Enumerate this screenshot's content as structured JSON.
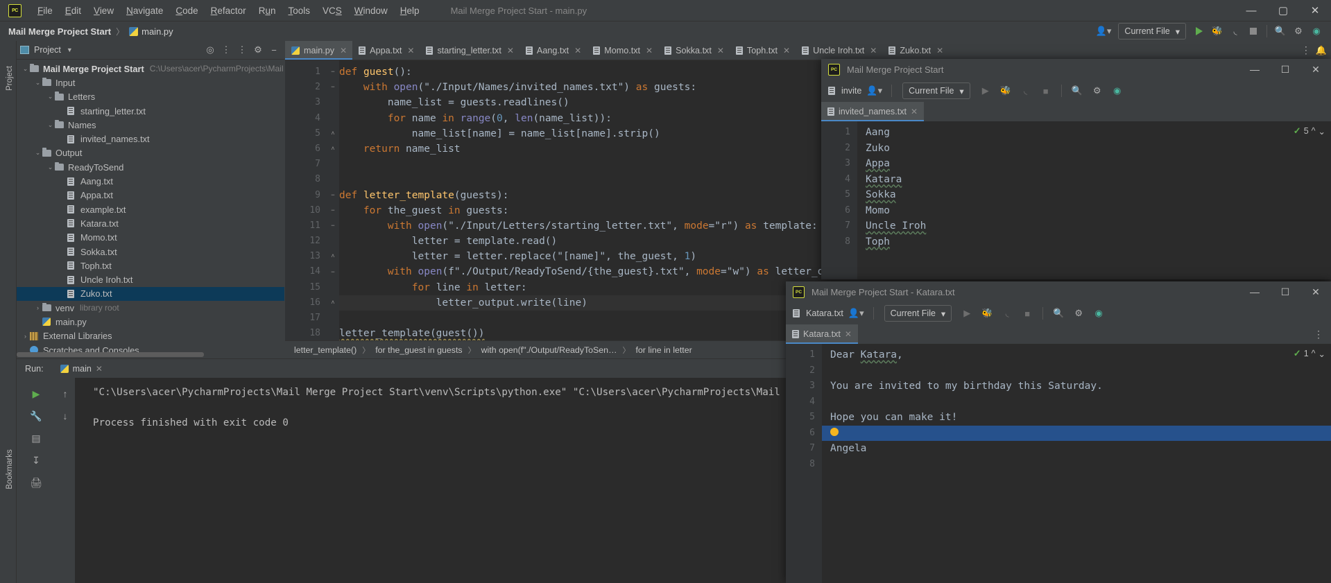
{
  "window": {
    "title": "Mail Merge Project Start - main.py",
    "app_icon": "PC",
    "minimize": "—",
    "maximize": "▢",
    "close": "✕"
  },
  "menu": [
    {
      "label": "File"
    },
    {
      "label": "Edit"
    },
    {
      "label": "View"
    },
    {
      "label": "Navigate"
    },
    {
      "label": "Code"
    },
    {
      "label": "Refactor"
    },
    {
      "label": "Run"
    },
    {
      "label": "Tools"
    },
    {
      "label": "VCS"
    },
    {
      "label": "Window"
    },
    {
      "label": "Help"
    }
  ],
  "navbar": {
    "project": "Mail Merge Project Start",
    "separator": "〉",
    "file": "main.py",
    "run_config": "Current File",
    "icons": [
      "user-dropdown-icon",
      "run-icon",
      "debug-icon",
      "coverage-icon",
      "stop-icon",
      "search-icon",
      "settings-icon",
      "ide-assistant-icon"
    ]
  },
  "left_strip": {
    "project_label": "Project",
    "bookmarks_label": "Bookmarks"
  },
  "project_panel": {
    "title": "Project",
    "actions": [
      "locate-icon",
      "expand-all-icon",
      "collapse-all-icon",
      "settings-icon",
      "hide-icon"
    ],
    "tree": [
      {
        "label": "Mail Merge Project Start",
        "path": "C:\\Users\\acer\\PycharmProjects\\Mail M",
        "depth": 0,
        "type": "folder",
        "arrow": "⌄",
        "bold": true
      },
      {
        "label": "Input",
        "depth": 1,
        "type": "folder",
        "arrow": "⌄"
      },
      {
        "label": "Letters",
        "depth": 2,
        "type": "folder",
        "arrow": "⌄"
      },
      {
        "label": "starting_letter.txt",
        "depth": 3,
        "type": "txt"
      },
      {
        "label": "Names",
        "depth": 2,
        "type": "folder",
        "arrow": "⌄"
      },
      {
        "label": "invited_names.txt",
        "depth": 3,
        "type": "txt"
      },
      {
        "label": "Output",
        "depth": 1,
        "type": "folder",
        "arrow": "⌄"
      },
      {
        "label": "ReadyToSend",
        "depth": 2,
        "type": "folder",
        "arrow": "⌄"
      },
      {
        "label": "Aang.txt",
        "depth": 3,
        "type": "txt"
      },
      {
        "label": "Appa.txt",
        "depth": 3,
        "type": "txt"
      },
      {
        "label": "example.txt",
        "depth": 3,
        "type": "txt"
      },
      {
        "label": "Katara.txt",
        "depth": 3,
        "type": "txt"
      },
      {
        "label": "Momo.txt",
        "depth": 3,
        "type": "txt"
      },
      {
        "label": "Sokka.txt",
        "depth": 3,
        "type": "txt"
      },
      {
        "label": "Toph.txt",
        "depth": 3,
        "type": "txt"
      },
      {
        "label": "Uncle Iroh.txt",
        "depth": 3,
        "type": "txt"
      },
      {
        "label": "Zuko.txt",
        "depth": 3,
        "type": "txt",
        "selected": true
      },
      {
        "label": "venv",
        "note": "library root",
        "depth": 1,
        "type": "folder",
        "arrow": "›"
      },
      {
        "label": "main.py",
        "depth": 1,
        "type": "py"
      },
      {
        "label": "External Libraries",
        "depth": 0,
        "type": "lib",
        "arrow": "›"
      },
      {
        "label": "Scratches and Consoles",
        "depth": 0,
        "type": "clock"
      }
    ]
  },
  "editor": {
    "tabs": [
      {
        "label": "main.py",
        "type": "py",
        "active": true
      },
      {
        "label": "Appa.txt",
        "type": "txt"
      },
      {
        "label": "starting_letter.txt",
        "type": "txt"
      },
      {
        "label": "Aang.txt",
        "type": "txt"
      },
      {
        "label": "Momo.txt",
        "type": "txt"
      },
      {
        "label": "Sokka.txt",
        "type": "txt"
      },
      {
        "label": "Toph.txt",
        "type": "txt"
      },
      {
        "label": "Uncle Iroh.txt",
        "type": "txt"
      },
      {
        "label": "Zuko.txt",
        "type": "txt"
      }
    ],
    "code_lines": [
      {
        "n": 1,
        "fold": "−",
        "text": "def guest():"
      },
      {
        "n": 2,
        "fold": "−",
        "text": "    with open(\"./Input/Names/invited_names.txt\") as guests:"
      },
      {
        "n": 3,
        "fold": "",
        "text": "        name_list = guests.readlines()"
      },
      {
        "n": 4,
        "fold": "",
        "text": "        for name in range(0, len(name_list)):"
      },
      {
        "n": 5,
        "fold": "˄",
        "text": "            name_list[name] = name_list[name].strip()"
      },
      {
        "n": 6,
        "fold": "˄",
        "text": "    return name_list"
      },
      {
        "n": 7,
        "fold": "",
        "text": ""
      },
      {
        "n": 8,
        "fold": "",
        "text": ""
      },
      {
        "n": 9,
        "fold": "−",
        "text": "def letter_template(guests):"
      },
      {
        "n": 10,
        "fold": "−",
        "text": "    for the_guest in guests:"
      },
      {
        "n": 11,
        "fold": "−",
        "text": "        with open(\"./Input/Letters/starting_letter.txt\", mode=\"r\") as template:"
      },
      {
        "n": 12,
        "fold": "",
        "text": "            letter = template.read()"
      },
      {
        "n": 13,
        "fold": "˄",
        "text": "            letter = letter.replace(\"[name]\", the_guest, 1)"
      },
      {
        "n": 14,
        "fold": "−",
        "text": "        with open(f\"./Output/ReadyToSend/{the_guest}.txt\", mode=\"w\") as letter_output"
      },
      {
        "n": 15,
        "fold": "",
        "text": "            for line in letter:"
      },
      {
        "n": 16,
        "fold": "˄",
        "text": "                letter_output.write(line)"
      },
      {
        "n": 17,
        "fold": "",
        "text": ""
      },
      {
        "n": 18,
        "fold": "",
        "text": "letter_template(guest())"
      }
    ],
    "breadcrumbs": [
      "letter_template()",
      "for the_guest in guests",
      "with open(f\"./Output/ReadyToSen…",
      "for line in letter"
    ]
  },
  "run_panel": {
    "label": "Run:",
    "tab": "main",
    "side_icons": [
      "rerun-icon",
      "scroll-up-icon",
      "settings-wrench-icon",
      "scroll-down-icon",
      "soft-wrap-icon",
      "scroll-to-end-icon",
      "print-icon"
    ],
    "output": [
      "\"C:\\Users\\acer\\PycharmProjects\\Mail Merge Project Start\\venv\\Scripts\\python.exe\" \"C:\\Users\\acer\\PycharmProjects\\Mail Merge Proje",
      "",
      "Process finished with exit code 0"
    ]
  },
  "float_window_1": {
    "title": "Mail Merge Project Start",
    "file_chip": "invite",
    "run_config": "Current File",
    "tab": "invited_names.txt",
    "inspect_count": "5",
    "lines": [
      {
        "n": 1,
        "text": "Aang",
        "spell": false
      },
      {
        "n": 2,
        "text": "Zuko",
        "spell": false
      },
      {
        "n": 3,
        "text": "Appa",
        "spell": true
      },
      {
        "n": 4,
        "text": "Katara",
        "spell": true
      },
      {
        "n": 5,
        "text": "Sokka",
        "spell": true
      },
      {
        "n": 6,
        "text": "Momo",
        "spell": false
      },
      {
        "n": 7,
        "text": "Uncle Iroh",
        "spell": true
      },
      {
        "n": 8,
        "text": "Toph",
        "spell": true
      }
    ]
  },
  "float_window_2": {
    "title": "Mail Merge Project Start - Katara.txt",
    "file_chip": "Katara.txt",
    "run_config": "Current File",
    "tab": "Katara.txt",
    "inspect_count": "1",
    "lines": [
      {
        "n": 1,
        "text": "Dear Katara,",
        "spell_word": "Katara"
      },
      {
        "n": 2,
        "text": ""
      },
      {
        "n": 3,
        "text": "You are invited to my birthday this Saturday."
      },
      {
        "n": 4,
        "text": ""
      },
      {
        "n": 5,
        "text": "Hope you can make it!"
      },
      {
        "n": 6,
        "text": "",
        "highlight": true
      },
      {
        "n": 7,
        "text": "Angela"
      },
      {
        "n": 8,
        "text": ""
      }
    ]
  },
  "colors": {
    "bg_panel": "#3c3f41",
    "bg_editor": "#2b2b2b",
    "gutter": "#313335",
    "selection": "#0d3a58",
    "tab_active": "#4e5254",
    "accent_blue": "#4a88c7",
    "keyword": "#cc7832",
    "string": "#6a8759",
    "function": "#ffc66d",
    "number": "#6897bb",
    "builtin": "#8888c6",
    "green_run": "#5fad4e",
    "highlight_line": "#26518c"
  }
}
